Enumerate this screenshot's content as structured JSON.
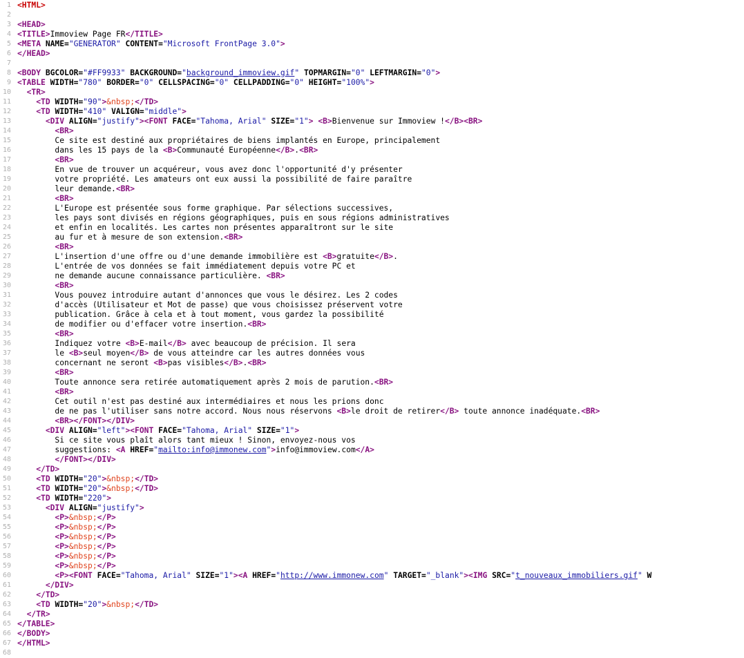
{
  "source_lines": [
    [
      [
        "tr",
        "<HTML>"
      ]
    ],
    [],
    [
      [
        "tg",
        "<HEAD>"
      ]
    ],
    [
      [
        "tg",
        "<TITLE>"
      ],
      [
        "tx",
        "Immoview Page FR"
      ],
      [
        "tg",
        "</TITLE>"
      ]
    ],
    [
      [
        "tg",
        "<META "
      ],
      [
        "at",
        "NAME="
      ],
      [
        "vl",
        "\"GENERATOR\""
      ],
      [
        "at",
        " CONTENT="
      ],
      [
        "vl",
        "\"Microsoft FrontPage 3.0\""
      ],
      [
        "tg",
        ">"
      ]
    ],
    [
      [
        "tg",
        "</HEAD>"
      ]
    ],
    [],
    [
      [
        "tg",
        "<BODY "
      ],
      [
        "at",
        "BGCOLOR="
      ],
      [
        "vl",
        "\"#FF9933\""
      ],
      [
        "at",
        " BACKGROUND="
      ],
      [
        "vl",
        "\""
      ],
      [
        "lk",
        "background_immoview.gif"
      ],
      [
        "vl",
        "\""
      ],
      [
        "at",
        " TOPMARGIN="
      ],
      [
        "vl",
        "\"0\""
      ],
      [
        "at",
        " LEFTMARGIN="
      ],
      [
        "vl",
        "\"0\""
      ],
      [
        "tg",
        ">"
      ]
    ],
    [
      [
        "tg",
        "<TABLE "
      ],
      [
        "at",
        "WIDTH="
      ],
      [
        "vl",
        "\"780\""
      ],
      [
        "at",
        " BORDER="
      ],
      [
        "vl",
        "\"0\""
      ],
      [
        "at",
        " CELLSPACING="
      ],
      [
        "vl",
        "\"0\""
      ],
      [
        "at",
        " CELLPADDING="
      ],
      [
        "vl",
        "\"0\""
      ],
      [
        "at",
        " HEIGHT="
      ],
      [
        "vl",
        "\"100%\""
      ],
      [
        "tg",
        ">"
      ]
    ],
    [
      [
        "tx",
        "  "
      ],
      [
        "tg",
        "<TR>"
      ]
    ],
    [
      [
        "tx",
        "    "
      ],
      [
        "tg",
        "<TD "
      ],
      [
        "at",
        "WIDTH="
      ],
      [
        "vl",
        "\"90\""
      ],
      [
        "tg",
        ">"
      ],
      [
        "en",
        "&nbsp;"
      ],
      [
        "tg",
        "</TD>"
      ]
    ],
    [
      [
        "tx",
        "    "
      ],
      [
        "tg",
        "<TD "
      ],
      [
        "at",
        "WIDTH="
      ],
      [
        "vl",
        "\"410\""
      ],
      [
        "at",
        " VALIGN="
      ],
      [
        "vl",
        "\"middle\""
      ],
      [
        "tg",
        ">"
      ]
    ],
    [
      [
        "tx",
        "      "
      ],
      [
        "tg",
        "<DIV "
      ],
      [
        "at",
        "ALIGN="
      ],
      [
        "vl",
        "\"justify\""
      ],
      [
        "tg",
        "><FONT "
      ],
      [
        "at",
        "FACE="
      ],
      [
        "vl",
        "\"Tahoma, Arial\""
      ],
      [
        "at",
        " SIZE="
      ],
      [
        "vl",
        "\"1\""
      ],
      [
        "tg",
        "> <B>"
      ],
      [
        "tx",
        "Bienvenue sur Immoview !"
      ],
      [
        "tg",
        "</B><BR>"
      ]
    ],
    [
      [
        "tx",
        "        "
      ],
      [
        "tg",
        "<BR>"
      ]
    ],
    [
      [
        "tx",
        "        Ce site est destiné aux propriétaires de biens implantés en Europe, principalement"
      ]
    ],
    [
      [
        "tx",
        "        dans les 15 pays de la "
      ],
      [
        "tg",
        "<B>"
      ],
      [
        "tx",
        "Communauté Européenne"
      ],
      [
        "tg",
        "</B>"
      ],
      [
        "tx",
        "."
      ],
      [
        "tg",
        "<BR>"
      ]
    ],
    [
      [
        "tx",
        "        "
      ],
      [
        "tg",
        "<BR>"
      ]
    ],
    [
      [
        "tx",
        "        En vue de trouver un acquéreur, vous avez donc l'opportunité d'y présenter"
      ]
    ],
    [
      [
        "tx",
        "        votre propriété. Les amateurs ont eux aussi la possibilité de faire paraître"
      ]
    ],
    [
      [
        "tx",
        "        leur demande."
      ],
      [
        "tg",
        "<BR>"
      ]
    ],
    [
      [
        "tx",
        "        "
      ],
      [
        "tg",
        "<BR>"
      ]
    ],
    [
      [
        "tx",
        "        L'Europe est présentée sous forme graphique. Par sélections successives,"
      ]
    ],
    [
      [
        "tx",
        "        les pays sont divisés en régions géographiques, puis en sous régions administratives"
      ]
    ],
    [
      [
        "tx",
        "        et enfin en localités. Les cartes non présentes apparaîtront sur le site"
      ]
    ],
    [
      [
        "tx",
        "        au fur et à mesure de son extension."
      ],
      [
        "tg",
        "<BR>"
      ]
    ],
    [
      [
        "tx",
        "        "
      ],
      [
        "tg",
        "<BR>"
      ]
    ],
    [
      [
        "tx",
        "        L'insertion d'une offre ou d'une demande immobilière est "
      ],
      [
        "tg",
        "<B>"
      ],
      [
        "tx",
        "gratuite"
      ],
      [
        "tg",
        "</B>"
      ],
      [
        "tx",
        "."
      ]
    ],
    [
      [
        "tx",
        "        L'entrée de vos données se fait immédiatement depuis votre PC et"
      ]
    ],
    [
      [
        "tx",
        "        ne demande aucune connaissance particulière. "
      ],
      [
        "tg",
        "<BR>"
      ]
    ],
    [
      [
        "tx",
        "        "
      ],
      [
        "tg",
        "<BR>"
      ]
    ],
    [
      [
        "tx",
        "        Vous pouvez introduire autant d'annonces que vous le désirez. Les 2 codes"
      ]
    ],
    [
      [
        "tx",
        "        d'accès (Utilisateur et Mot de passe) que vous choisissez préservent votre"
      ]
    ],
    [
      [
        "tx",
        "        publication. Grâce à cela et à tout moment, vous gardez la possibilité"
      ]
    ],
    [
      [
        "tx",
        "        de modifier ou d'effacer votre insertion."
      ],
      [
        "tg",
        "<BR>"
      ]
    ],
    [
      [
        "tx",
        "        "
      ],
      [
        "tg",
        "<BR>"
      ]
    ],
    [
      [
        "tx",
        "        Indiquez votre "
      ],
      [
        "tg",
        "<B>"
      ],
      [
        "tx",
        "E-mail"
      ],
      [
        "tg",
        "</B>"
      ],
      [
        "tx",
        " avec beaucoup de précision. Il sera"
      ]
    ],
    [
      [
        "tx",
        "        le "
      ],
      [
        "tg",
        "<B>"
      ],
      [
        "tx",
        "seul moyen"
      ],
      [
        "tg",
        "</B>"
      ],
      [
        "tx",
        " de vous atteindre car les autres données vous"
      ]
    ],
    [
      [
        "tx",
        "        concernant ne seront "
      ],
      [
        "tg",
        "<B>"
      ],
      [
        "tx",
        "pas visibles"
      ],
      [
        "tg",
        "</B>"
      ],
      [
        "tx",
        "."
      ],
      [
        "tg",
        "<BR>"
      ]
    ],
    [
      [
        "tx",
        "        "
      ],
      [
        "tg",
        "<BR>"
      ]
    ],
    [
      [
        "tx",
        "        Toute annonce sera retirée automatiquement après 2 mois de parution."
      ],
      [
        "tg",
        "<BR>"
      ]
    ],
    [
      [
        "tx",
        "        "
      ],
      [
        "tg",
        "<BR>"
      ]
    ],
    [
      [
        "tx",
        "        Cet outil n'est pas destiné aux intermédiaires et nous les prions donc"
      ]
    ],
    [
      [
        "tx",
        "        de ne pas l'utiliser sans notre accord. Nous nous réservons "
      ],
      [
        "tg",
        "<B>"
      ],
      [
        "tx",
        "le droit de retirer"
      ],
      [
        "tg",
        "</B>"
      ],
      [
        "tx",
        " toute annonce inadéquate."
      ],
      [
        "tg",
        "<BR>"
      ]
    ],
    [
      [
        "tx",
        "        "
      ],
      [
        "tg",
        "<BR></FONT></DIV>"
      ]
    ],
    [
      [
        "tx",
        "      "
      ],
      [
        "tg",
        "<DIV "
      ],
      [
        "at",
        "ALIGN="
      ],
      [
        "vl",
        "\"left\""
      ],
      [
        "tg",
        "><FONT "
      ],
      [
        "at",
        "FACE="
      ],
      [
        "vl",
        "\"Tahoma, Arial\""
      ],
      [
        "at",
        " SIZE="
      ],
      [
        "vl",
        "\"1\""
      ],
      [
        "tg",
        ">"
      ]
    ],
    [
      [
        "tx",
        "        Si ce site vous plaît alors tant mieux ! Sinon, envoyez-nous vos"
      ]
    ],
    [
      [
        "tx",
        "        suggestions: "
      ],
      [
        "tg",
        "<A "
      ],
      [
        "at",
        "HREF="
      ],
      [
        "vl",
        "\""
      ],
      [
        "lk",
        "mailto:info@immonew.com"
      ],
      [
        "vl",
        "\""
      ],
      [
        "tg",
        ">"
      ],
      [
        "tx",
        "info@immoview.com"
      ],
      [
        "tg",
        "</A>"
      ]
    ],
    [
      [
        "tx",
        "        "
      ],
      [
        "tg",
        "</FONT></DIV>"
      ]
    ],
    [
      [
        "tx",
        "    "
      ],
      [
        "tg",
        "</TD>"
      ]
    ],
    [
      [
        "tx",
        "    "
      ],
      [
        "tg",
        "<TD "
      ],
      [
        "at",
        "WIDTH="
      ],
      [
        "vl",
        "\"20\""
      ],
      [
        "tg",
        ">"
      ],
      [
        "en",
        "&nbsp;"
      ],
      [
        "tg",
        "</TD>"
      ]
    ],
    [
      [
        "tx",
        "    "
      ],
      [
        "tg",
        "<TD "
      ],
      [
        "at",
        "WIDTH="
      ],
      [
        "vl",
        "\"20\""
      ],
      [
        "tg",
        ">"
      ],
      [
        "en",
        "&nbsp;"
      ],
      [
        "tg",
        "</TD>"
      ]
    ],
    [
      [
        "tx",
        "    "
      ],
      [
        "tg",
        "<TD "
      ],
      [
        "at",
        "WIDTH="
      ],
      [
        "vl",
        "\"220\""
      ],
      [
        "tg",
        ">"
      ]
    ],
    [
      [
        "tx",
        "      "
      ],
      [
        "tg",
        "<DIV "
      ],
      [
        "at",
        "ALIGN="
      ],
      [
        "vl",
        "\"justify\""
      ],
      [
        "tg",
        ">"
      ]
    ],
    [
      [
        "tx",
        "        "
      ],
      [
        "tg",
        "<P>"
      ],
      [
        "en",
        "&nbsp;"
      ],
      [
        "tg",
        "</P>"
      ]
    ],
    [
      [
        "tx",
        "        "
      ],
      [
        "tg",
        "<P>"
      ],
      [
        "en",
        "&nbsp;"
      ],
      [
        "tg",
        "</P>"
      ]
    ],
    [
      [
        "tx",
        "        "
      ],
      [
        "tg",
        "<P>"
      ],
      [
        "en",
        "&nbsp;"
      ],
      [
        "tg",
        "</P>"
      ]
    ],
    [
      [
        "tx",
        "        "
      ],
      [
        "tg",
        "<P>"
      ],
      [
        "en",
        "&nbsp;"
      ],
      [
        "tg",
        "</P>"
      ]
    ],
    [
      [
        "tx",
        "        "
      ],
      [
        "tg",
        "<P>"
      ],
      [
        "en",
        "&nbsp;"
      ],
      [
        "tg",
        "</P>"
      ]
    ],
    [
      [
        "tx",
        "        "
      ],
      [
        "tg",
        "<P>"
      ],
      [
        "en",
        "&nbsp;"
      ],
      [
        "tg",
        "</P>"
      ]
    ],
    [
      [
        "tx",
        "        "
      ],
      [
        "tg",
        "<P><FONT "
      ],
      [
        "at",
        "FACE="
      ],
      [
        "vl",
        "\"Tahoma, Arial\""
      ],
      [
        "at",
        " SIZE="
      ],
      [
        "vl",
        "\"1\""
      ],
      [
        "tg",
        "><A "
      ],
      [
        "at",
        "HREF="
      ],
      [
        "vl",
        "\""
      ],
      [
        "lk",
        "http://www.immonew.com"
      ],
      [
        "vl",
        "\""
      ],
      [
        "at",
        " TARGET="
      ],
      [
        "vl",
        "\"_blank\""
      ],
      [
        "tg",
        "><IMG "
      ],
      [
        "at",
        "SRC="
      ],
      [
        "vl",
        "\""
      ],
      [
        "lk",
        "t_nouveaux_immobiliers.gif"
      ],
      [
        "vl",
        "\""
      ],
      [
        "at",
        " W"
      ]
    ],
    [
      [
        "tx",
        "      "
      ],
      [
        "tg",
        "</DIV>"
      ]
    ],
    [
      [
        "tx",
        "    "
      ],
      [
        "tg",
        "</TD>"
      ]
    ],
    [
      [
        "tx",
        "    "
      ],
      [
        "tg",
        "<TD "
      ],
      [
        "at",
        "WIDTH="
      ],
      [
        "vl",
        "\"20\""
      ],
      [
        "tg",
        ">"
      ],
      [
        "en",
        "&nbsp;"
      ],
      [
        "tg",
        "</TD>"
      ]
    ],
    [
      [
        "tx",
        "  "
      ],
      [
        "tg",
        "</TR>"
      ]
    ],
    [
      [
        "tg",
        "</TABLE>"
      ]
    ],
    [
      [
        "tg",
        "</BODY>"
      ]
    ],
    [
      [
        "tg",
        "</HTML>"
      ]
    ],
    []
  ]
}
